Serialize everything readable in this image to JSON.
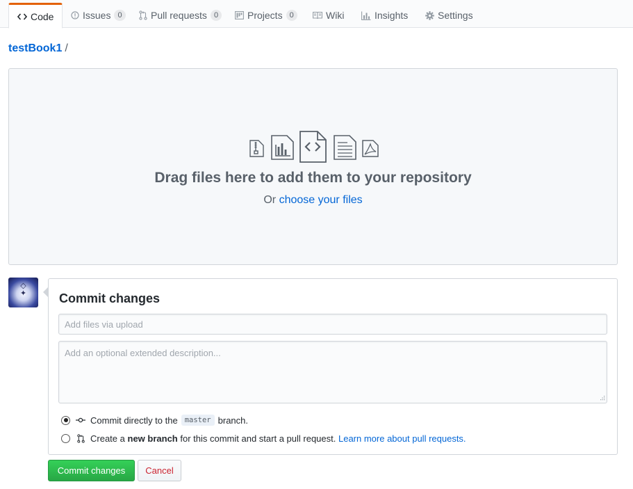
{
  "tabs": [
    {
      "label": "Code",
      "icon": "code-icon",
      "selected": true
    },
    {
      "label": "Issues",
      "icon": "issue-opened-icon",
      "count": "0"
    },
    {
      "label": "Pull requests",
      "icon": "git-pull-request-icon",
      "count": "0"
    },
    {
      "label": "Projects",
      "icon": "project-icon",
      "count": "0"
    },
    {
      "label": "Wiki",
      "icon": "book-icon"
    },
    {
      "label": "Insights",
      "icon": "graph-icon"
    },
    {
      "label": "Settings",
      "icon": "gear-icon"
    }
  ],
  "breadcrumb": {
    "repo": "testBook1",
    "separator": "/"
  },
  "dropzone": {
    "icons": [
      "file-zip-icon",
      "graph-file-icon",
      "file-code-icon",
      "file-text-icon",
      "file-pdf-icon"
    ],
    "title": "Drag files here to add them to your repository",
    "or_text": "Or",
    "choose_link": "choose your files"
  },
  "commit": {
    "title": "Commit changes",
    "summary_placeholder": "Add files via upload",
    "description_placeholder": "Add an optional extended description...",
    "option_direct": {
      "prefix": "Commit directly to the",
      "branch": "master",
      "suffix": "branch.",
      "selected": true
    },
    "option_new_branch": {
      "prefix": "Create a",
      "bold": "new branch",
      "middle": "for this commit and start a pull request.",
      "link": "Learn more about pull requests.",
      "selected": false
    }
  },
  "buttons": {
    "commit": "Commit changes",
    "cancel": "Cancel"
  },
  "colors": {
    "accent_link": "#0366d6",
    "selected_tab_border": "#e36209",
    "primary_button": "#28a745",
    "cancel_text": "#cb2431"
  }
}
